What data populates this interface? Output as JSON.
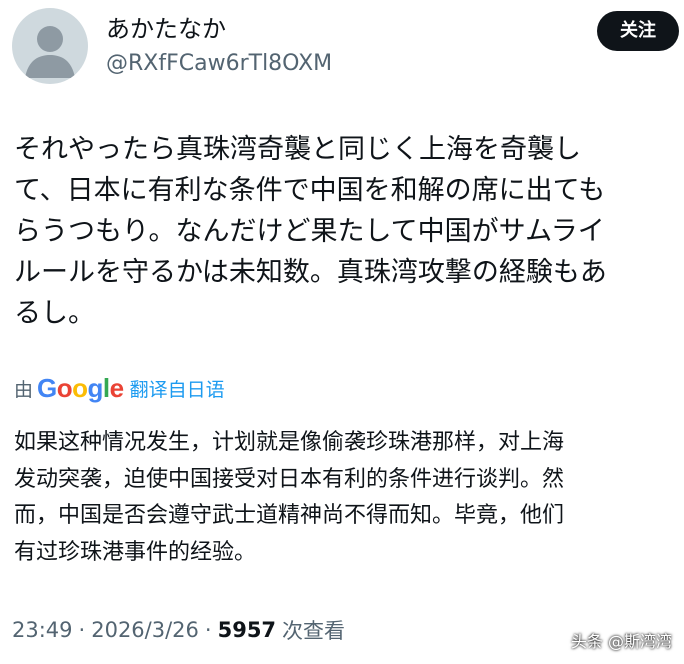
{
  "author": {
    "display_name": "あかたなか",
    "handle": "@RXfFCaw6rTl8OXM",
    "avatar_icon": "default-avatar-icon"
  },
  "follow_button": {
    "label": "关注"
  },
  "tweet": {
    "lines": [
      "それやったら真珠湾奇襲と同じく上海を奇襲し",
      "て、日本に有利な条件で中国を和解の席に出ても",
      "らうつもり。なんだけど果たして中国がサムライ",
      "ルールを守るかは未知数。真珠湾攻撃の経験もあ",
      "るし。"
    ]
  },
  "translation": {
    "by": "由",
    "google_letters": [
      "G",
      "o",
      "o",
      "g",
      "l",
      "e"
    ],
    "label": "翻译自日语",
    "lines": [
      "如果这种情况发生，计划就是像偷袭珍珠港那样，对上海",
      "发动突袭，迫使中国接受对日本有利的条件进行谈判。然",
      "而，中国是否会遵守武士道精神尚不得而知。毕竟，他们",
      "有过珍珠港事件的经验。"
    ]
  },
  "meta": {
    "time": "23:49",
    "separator": "·",
    "date": "2026/3/26",
    "separator2": "·",
    "view_count": "5957",
    "view_label": "次查看"
  },
  "watermark": {
    "text": "头条 @斯湾湾"
  },
  "colors": {
    "text": "#0f1419",
    "secondary": "#536471",
    "link": "#1d9bf0",
    "follow_bg": "#0f1419",
    "avatar_bg": "#cfd9de"
  }
}
